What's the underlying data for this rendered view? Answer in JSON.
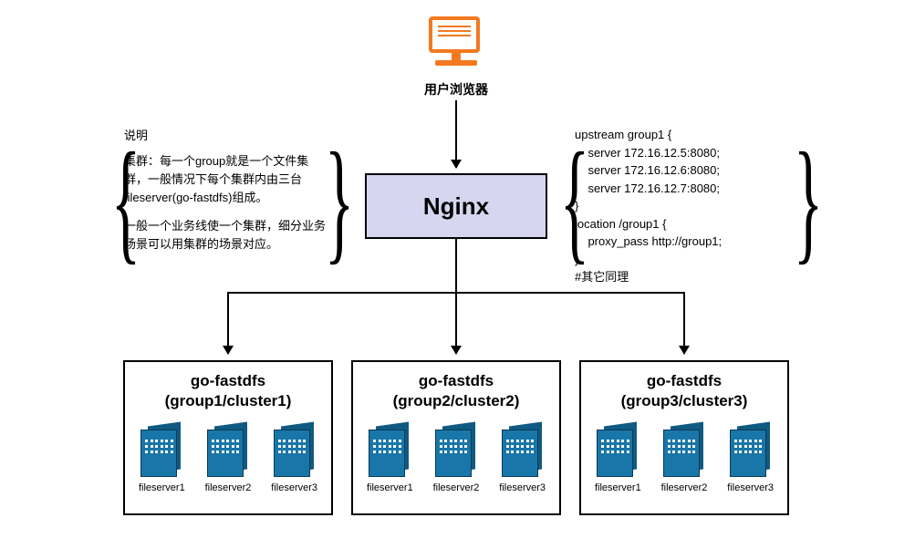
{
  "browser_label": "用户浏览器",
  "nginx_label": "Nginx",
  "note_left": {
    "title": "说明",
    "para1": "集群：每一个group就是一个文件集群，一般情况下每个集群内由三台fileserver(go-fastdfs)组成。",
    "para2": "一般一个业务线使一个集群，细分业务场景可以用集群的场景对应。"
  },
  "note_right": "upstream group1 {\n    server 172.16.12.5:8080;\n    server 172.16.12.6:8080;\n    server 172.16.12.7:8080;\n}\nlocation /group1 {\n    proxy_pass http://group1;\n}\n#其它同理",
  "clusters": [
    {
      "title_line1": "go-fastdfs",
      "title_line2": "(group1/cluster1)",
      "servers": [
        "fileserver1",
        "fileserver2",
        "fileserver3"
      ]
    },
    {
      "title_line1": "go-fastdfs",
      "title_line2": "(group2/cluster2)",
      "servers": [
        "fileserver1",
        "fileserver2",
        "fileserver3"
      ]
    },
    {
      "title_line1": "go-fastdfs",
      "title_line2": "(group3/cluster3)",
      "servers": [
        "fileserver1",
        "fileserver2",
        "fileserver3"
      ]
    }
  ],
  "chart_data": {
    "type": "diagram",
    "topology": "client → nginx → [group1, group2, group3]",
    "nodes": [
      {
        "id": "browser",
        "label": "用户浏览器",
        "kind": "client"
      },
      {
        "id": "nginx",
        "label": "Nginx",
        "kind": "reverse-proxy"
      },
      {
        "id": "group1",
        "label": "go-fastdfs (group1/cluster1)",
        "servers": [
          "fileserver1",
          "fileserver2",
          "fileserver3"
        ]
      },
      {
        "id": "group2",
        "label": "go-fastdfs (group2/cluster2)",
        "servers": [
          "fileserver1",
          "fileserver2",
          "fileserver3"
        ]
      },
      {
        "id": "group3",
        "label": "go-fastdfs (group3/cluster3)",
        "servers": [
          "fileserver1",
          "fileserver2",
          "fileserver3"
        ]
      }
    ],
    "edges": [
      [
        "browser",
        "nginx"
      ],
      [
        "nginx",
        "group1"
      ],
      [
        "nginx",
        "group2"
      ],
      [
        "nginx",
        "group3"
      ]
    ],
    "annotations": {
      "left_note": "说明 集群：每一个group就是一个文件集群，一般情况下每个集群内由三台fileserver(go-fastdfs)组成。一般一个业务线使一个集群，细分业务场景可以用集群的场景对应。",
      "right_config": "upstream group1 { server 172.16.12.5:8080; server 172.16.12.6:8080; server 172.16.12.7:8080; } location /group1 { proxy_pass http://group1; } #其它同理"
    }
  }
}
